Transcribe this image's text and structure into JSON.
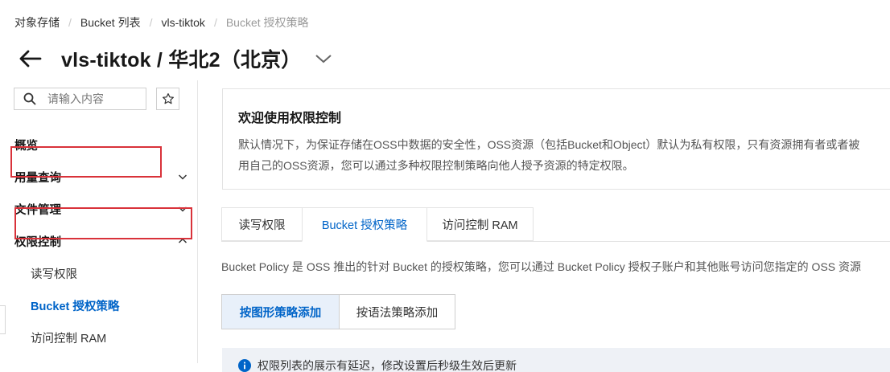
{
  "breadcrumb": {
    "items": [
      "对象存储",
      "Bucket 列表",
      "vls-tiktok"
    ],
    "current": "Bucket 授权策略"
  },
  "header": {
    "title": "vls-tiktok / 华北2（北京）"
  },
  "sidebar": {
    "search_placeholder": "请输入内容",
    "items": [
      {
        "label": "概览"
      },
      {
        "label": "用量查询"
      },
      {
        "label": "文件管理"
      },
      {
        "label": "权限控制"
      }
    ],
    "sub_items": [
      {
        "label": "读写权限"
      },
      {
        "label": "Bucket 授权策略"
      },
      {
        "label": "访问控制 RAM"
      }
    ]
  },
  "welcome": {
    "title": "欢迎使用权限控制",
    "line1": "默认情况下，为保证存储在OSS中数据的安全性，OSS资源（包括Bucket和Object）默认为私有权限，只有资源拥有者或者被",
    "line2": "用自己的OSS资源，您可以通过多种权限控制策略向他人授予资源的特定权限。"
  },
  "tabs": [
    {
      "label": "读写权限"
    },
    {
      "label": "Bucket 授权策略"
    },
    {
      "label": "访问控制 RAM"
    }
  ],
  "policy_description": "Bucket Policy 是 OSS 推出的针对 Bucket 的授权策略，您可以通过 Bucket Policy 授权子账户和其他账号访问您指定的 OSS 资源",
  "buttons": {
    "graphic_add": "按图形策略添加",
    "syntax_add": "按语法策略添加"
  },
  "notice": {
    "text": "权限列表的展示有延迟，修改设置后秒级生效后更新"
  },
  "colors": {
    "accent": "#0064c8",
    "highlight": "#d9323a"
  }
}
